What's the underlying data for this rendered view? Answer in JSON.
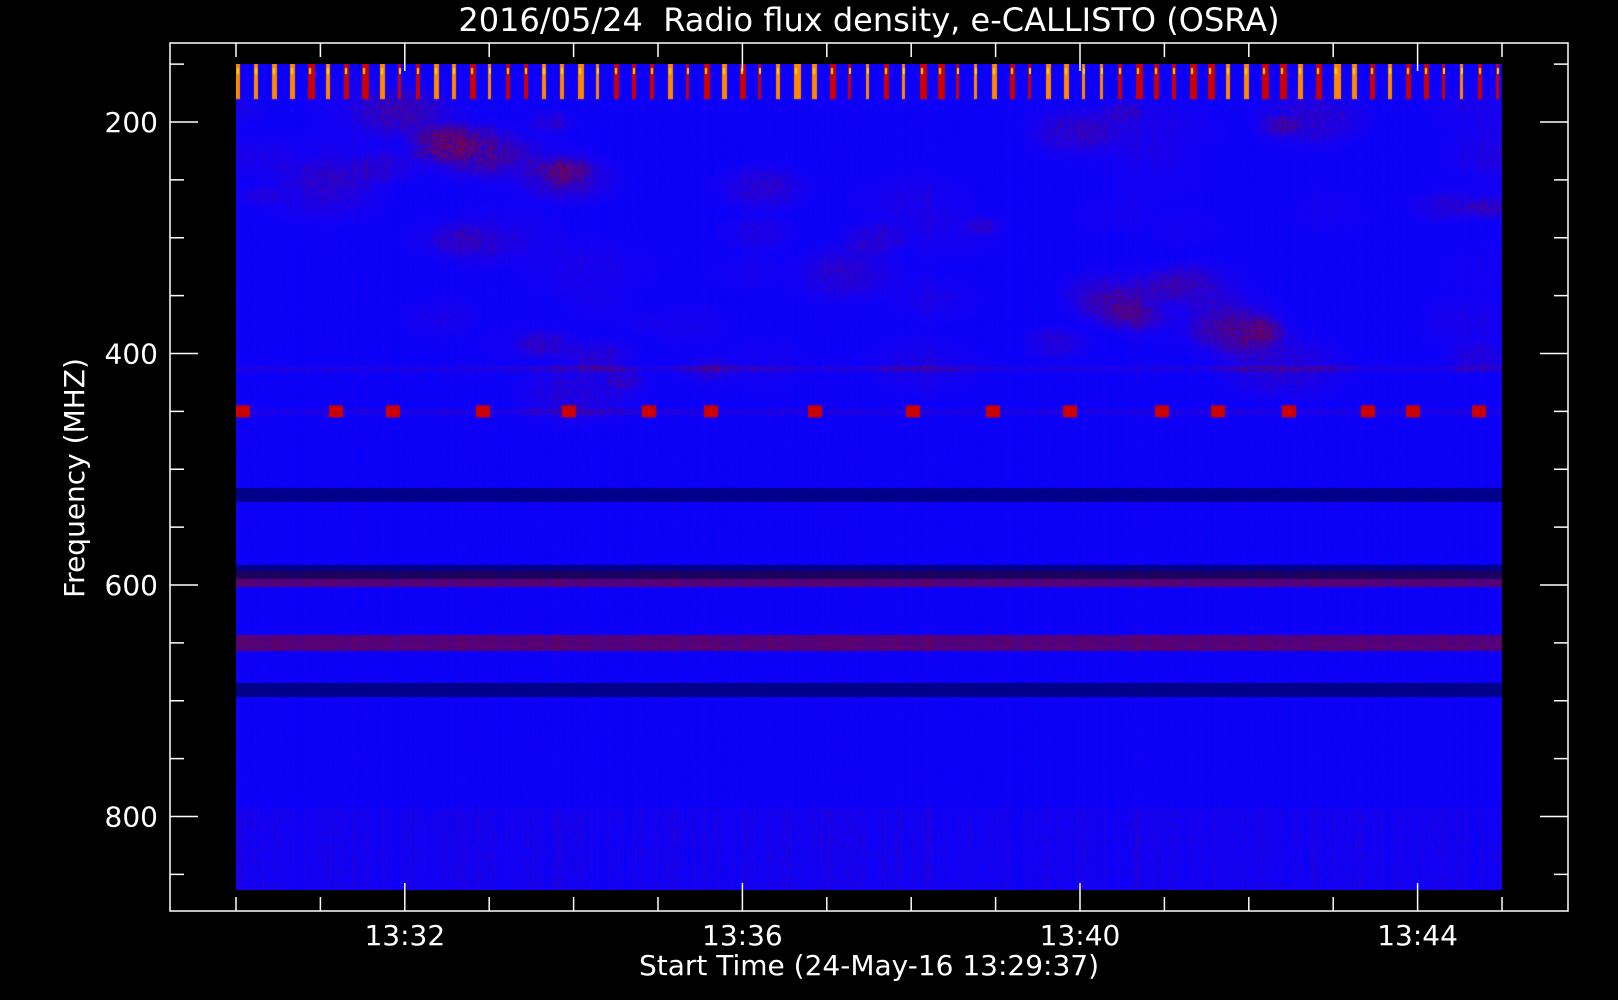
{
  "chart_data": {
    "type": "heatmap",
    "title": "2016/05/24  Radio flux density, e-CALLISTO (OSRA)",
    "xlabel": "Start Time (24-May-16 13:29:37)",
    "ylabel": "Frequency (MHZ)",
    "x_ticks": [
      "13:32",
      "13:36",
      "13:40",
      "13:44"
    ],
    "y_ticks": [
      "200",
      "400",
      "600",
      "800"
    ],
    "xlim": [
      "13:30:00",
      "13:45:00"
    ],
    "ylim": [
      870,
      150
    ],
    "y_axis_inverted": true,
    "colormap": [
      "#0000ff",
      "#1a00ee",
      "#6a0050",
      "#cc0000",
      "#ff2200",
      "#ff8800",
      "#ffdd00",
      "#ffffff"
    ],
    "background_color": "#0000ff",
    "features": [
      {
        "kind": "periodic_bursts",
        "freq_range_mhz": [
          150,
          170
        ],
        "description_color": "#ff8800"
      },
      {
        "kind": "interference_line",
        "freq_mhz": 450,
        "color": "#cc0000"
      },
      {
        "kind": "interference_line",
        "freq_mhz": 413,
        "color": "#cc0000"
      },
      {
        "kind": "dark_band",
        "freq_mhz": 522
      },
      {
        "kind": "dark_band",
        "freq_mhz": 588
      },
      {
        "kind": "dark_band",
        "freq_mhz": 690
      },
      {
        "kind": "red_band",
        "freq_mhz": 650
      },
      {
        "kind": "red_band",
        "freq_mhz": 594
      }
    ]
  }
}
